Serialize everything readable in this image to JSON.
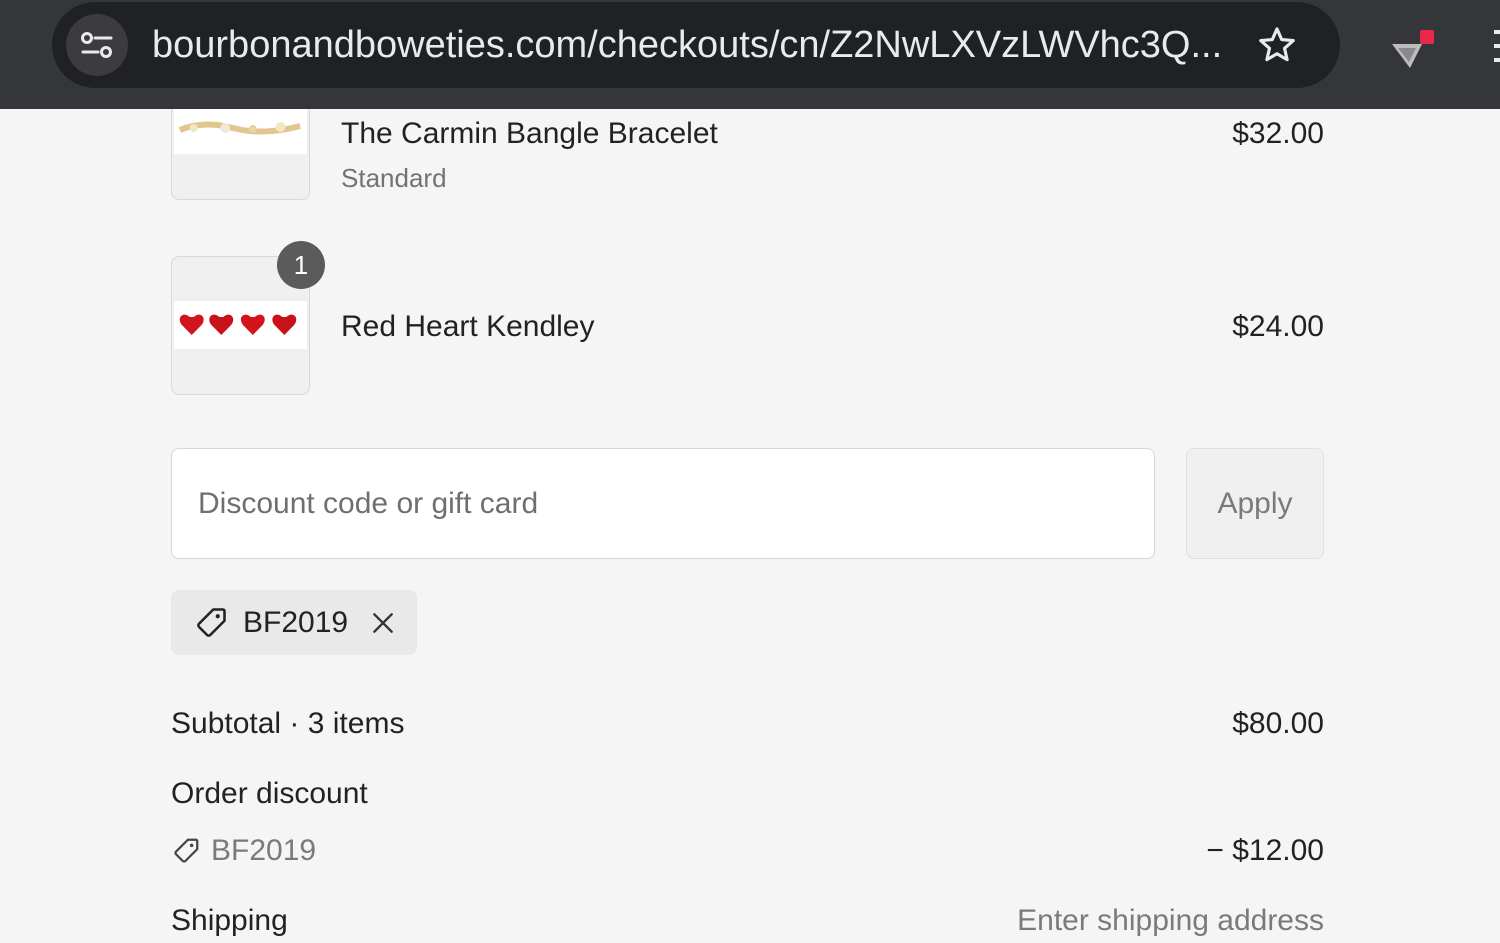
{
  "browser": {
    "url": "bourbonandboweties.com/checkouts/cn/Z2NwLXVzLWVhc3Q...",
    "icons": [
      "tune-icon",
      "star-icon",
      "extension-icon"
    ]
  },
  "cart": {
    "items": [
      {
        "name": "The Carmin Bangle Bracelet",
        "variant": "Standard",
        "price": "$32.00"
      },
      {
        "name": "Red Heart Kendley",
        "quantity": "1",
        "price": "$24.00"
      }
    ]
  },
  "discount": {
    "placeholder": "Discount code or gift card",
    "apply_label": "Apply",
    "applied_code": "BF2019"
  },
  "summary": {
    "subtotal_label": "Subtotal · 3 items",
    "subtotal_value": "$80.00",
    "order_discount_label": "Order discount",
    "discount_code": "BF2019",
    "discount_value": "− $12.00",
    "shipping_label": "Shipping",
    "shipping_value": "Enter shipping address"
  },
  "colors": {
    "browser_bar": "#35363a",
    "omnibox": "#202124",
    "page_bg": "#f5f5f5",
    "badge": "#5b5b5b",
    "extension_red": "#e8294a"
  }
}
